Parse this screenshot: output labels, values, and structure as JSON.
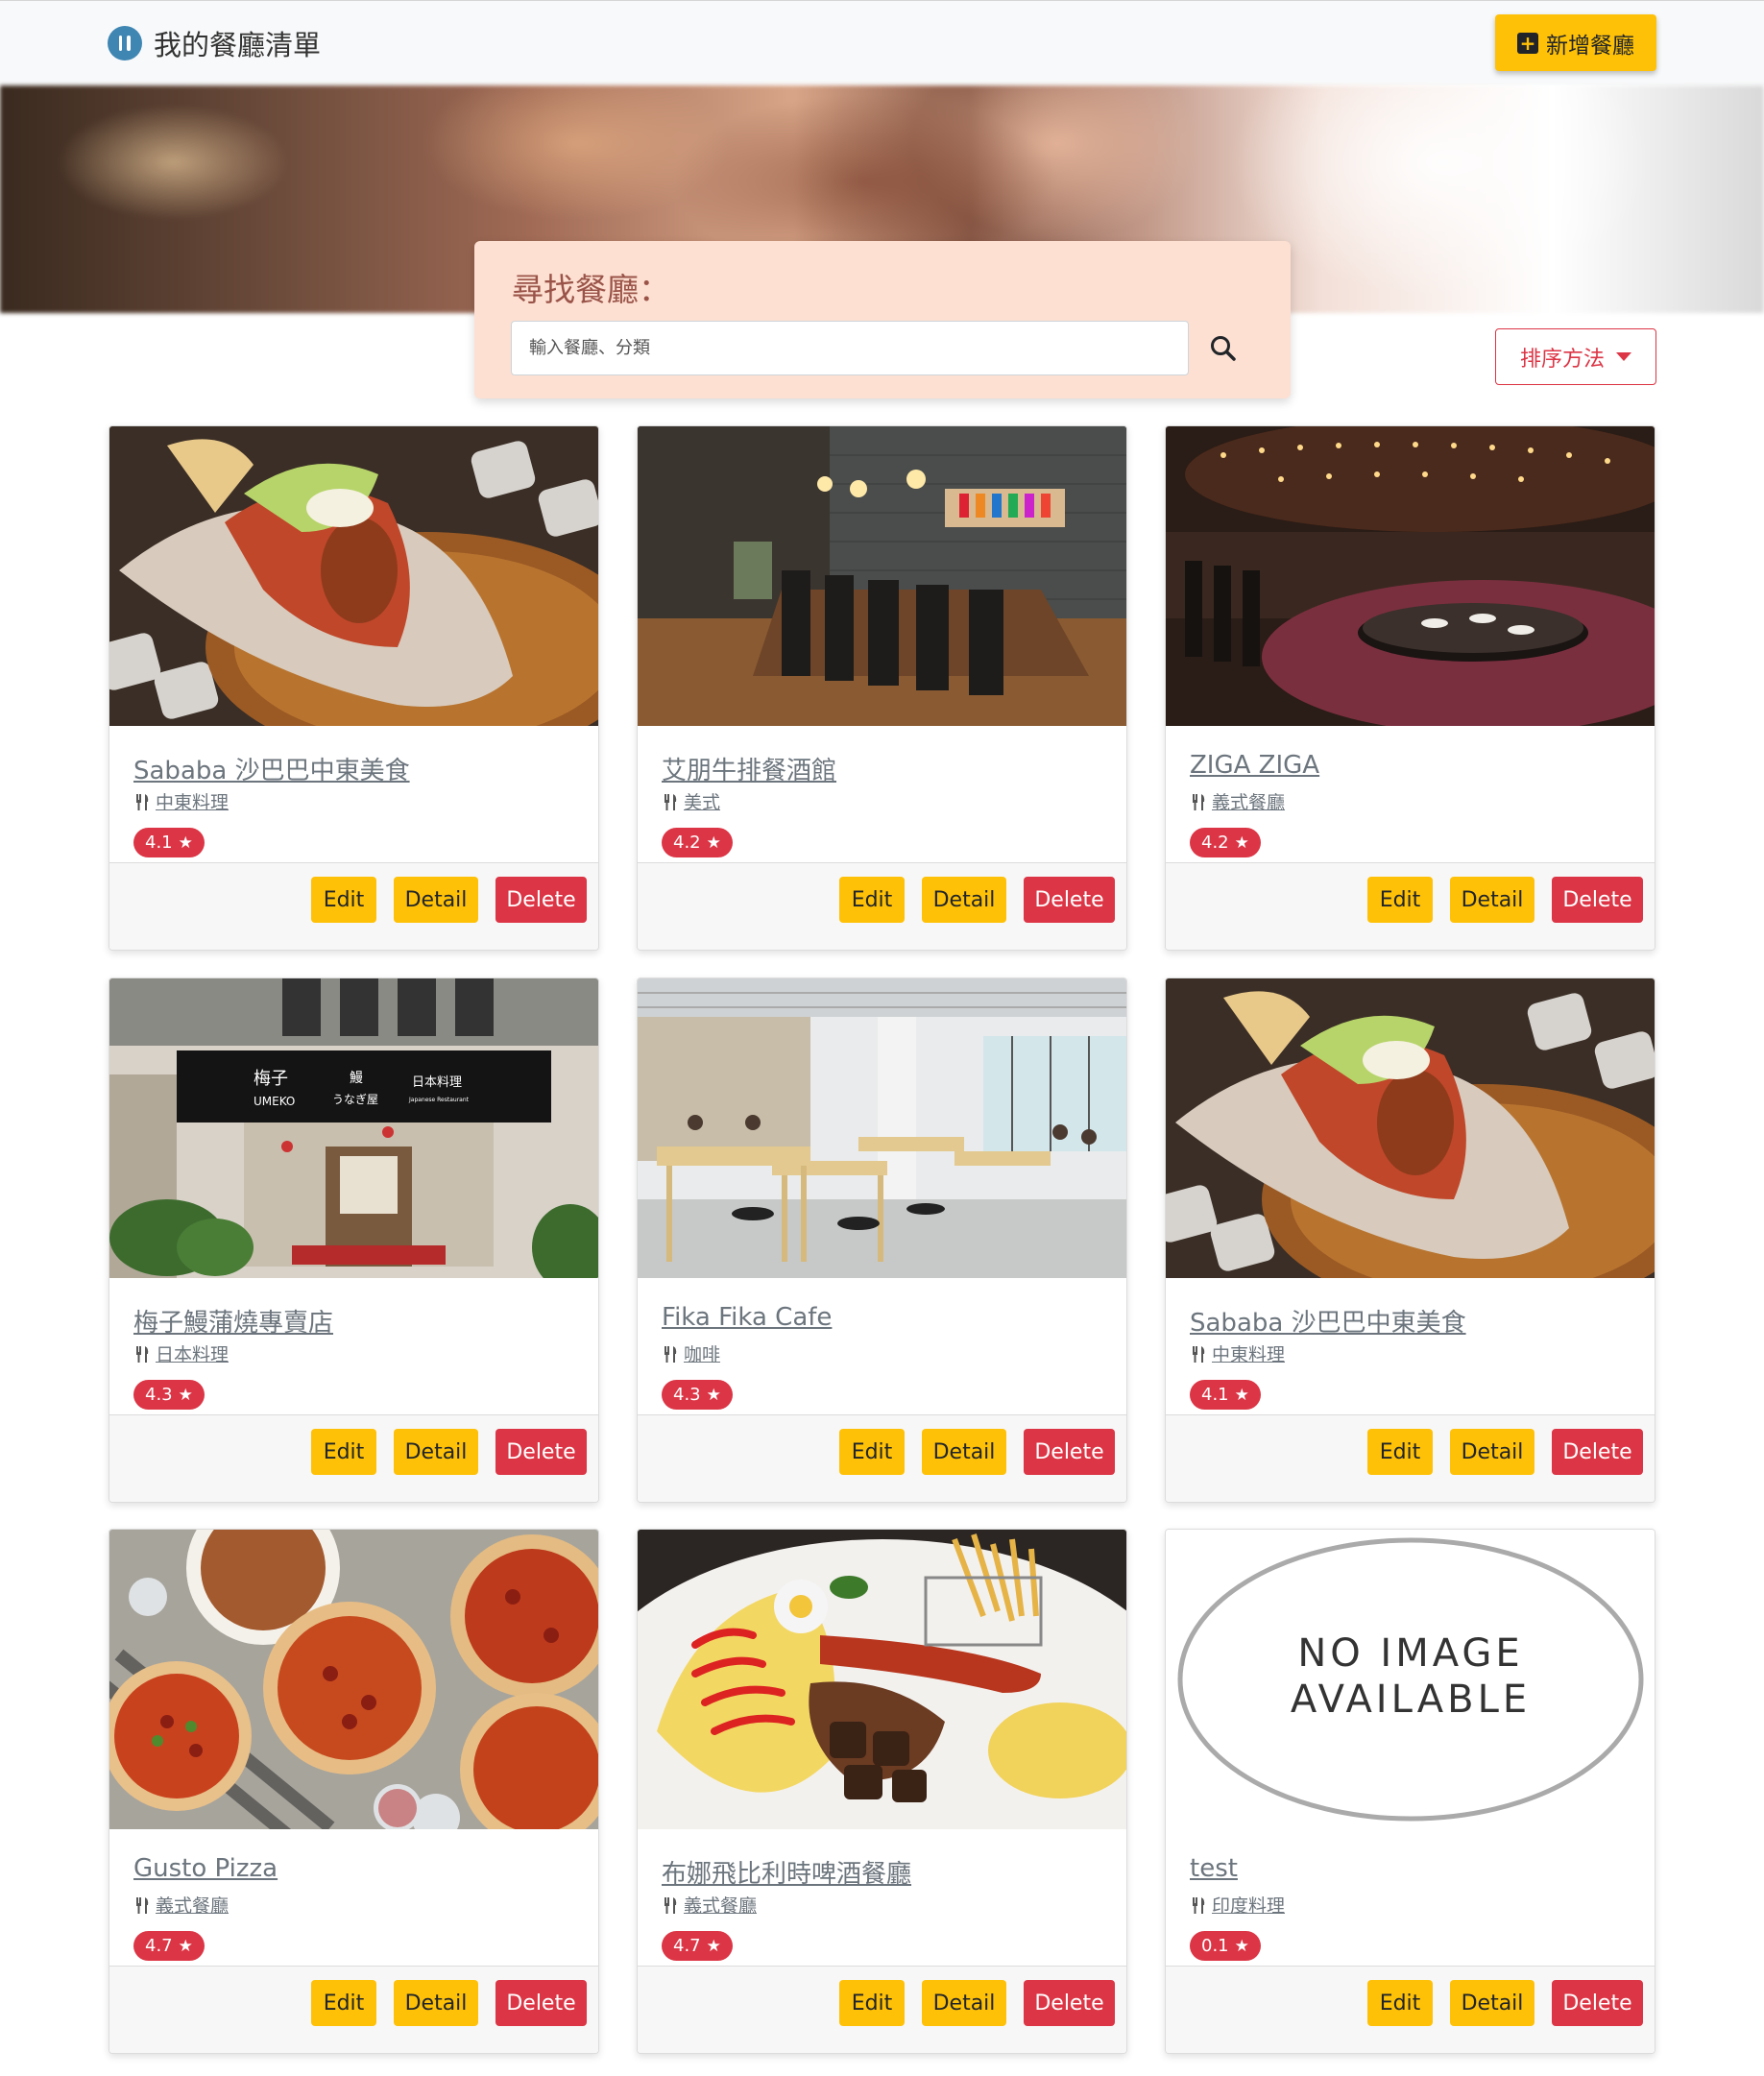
{
  "navbar": {
    "brand": "我的餐廳清單",
    "add_button": "新增餐廳"
  },
  "search": {
    "title": "尋找餐廳：",
    "placeholder": "輸入餐廳、分類"
  },
  "sort": {
    "label": "排序方法"
  },
  "restaurants": [
    {
      "name": "Sababa 沙巴巴中東美食",
      "category": "中東料理",
      "rating": "4.1",
      "image": "pita-sandwich"
    },
    {
      "name": "艾朋牛排餐酒館",
      "category": "美式",
      "rating": "4.2",
      "image": "dark-dining-room"
    },
    {
      "name": "ZIGA ZIGA",
      "category": "義式餐廳",
      "rating": "4.2",
      "image": "lounge-interior"
    },
    {
      "name": "梅子鰻蒲燒專賣店",
      "category": "日本料理",
      "rating": "4.3",
      "image": "storefront"
    },
    {
      "name": "Fika Fika Cafe",
      "category": "咖啡",
      "rating": "4.3",
      "image": "bright-cafe"
    },
    {
      "name": "Sababa 沙巴巴中東美食",
      "category": "中東料理",
      "rating": "4.1",
      "image": "pita-sandwich"
    },
    {
      "name": "Gusto Pizza",
      "category": "義式餐廳",
      "rating": "4.7",
      "image": "pizzas"
    },
    {
      "name": "布娜飛比利時啤酒餐廳",
      "category": "義式餐廳",
      "rating": "4.7",
      "image": "omelette-plate"
    },
    {
      "name": "test",
      "category": "印度料理",
      "rating": "0.1",
      "image": "no-image"
    }
  ],
  "card_actions": {
    "edit": "Edit",
    "detail": "Detail",
    "delete": "Delete"
  },
  "no_image_text": [
    "NO IMAGE",
    "AVAILABLE"
  ],
  "storefront_sign": {
    "name": "梅子",
    "roman": "UMEKO",
    "eel": "鰻",
    "eel_kana": "うなぎ屋",
    "cuisine": "日本料理",
    "cuisine_en": "Japanese Restaurant"
  },
  "colors": {
    "accent": "#ffc107",
    "danger": "#dc3545",
    "search_bg": "#fde0d2",
    "brand_icon": "#3f86b3"
  }
}
